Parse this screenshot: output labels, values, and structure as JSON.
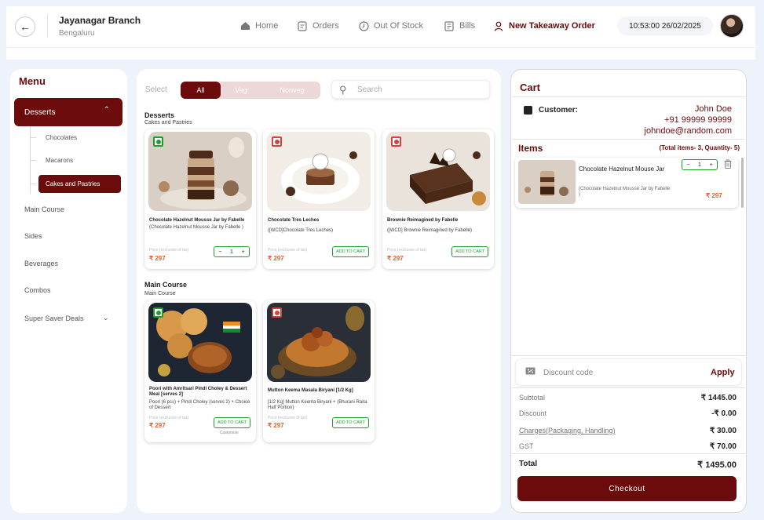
{
  "header": {
    "back_icon": "arrow-left-icon",
    "branch_name": "Jayanagar Branch",
    "city": "Bengaluru",
    "nav": [
      {
        "label": "Home",
        "icon": "home-icon"
      },
      {
        "label": "Orders",
        "icon": "orders-icon"
      },
      {
        "label": "Out Of Stock",
        "icon": "clock-icon"
      },
      {
        "label": "Bills",
        "icon": "bills-icon"
      },
      {
        "label": "New Takeaway Order",
        "icon": "person-icon",
        "active": true
      }
    ],
    "datetime": "10:53:00  26/02/2025"
  },
  "menu": {
    "title": "Menu",
    "active_category": "Desserts",
    "subcategories": [
      "Chocolates",
      "Macarons",
      "Cakes and Pastries"
    ],
    "active_subcategory": "Cakes and Pastries",
    "categories": [
      "Main Course",
      "Sides",
      "Beverages",
      "Combos",
      "Super Saver Deals"
    ]
  },
  "filters": {
    "label": "Select",
    "options": [
      "All",
      "Veg",
      "Nonveg"
    ],
    "selected": "All",
    "search_placeholder": "Search"
  },
  "sections": [
    {
      "title": "Desserts",
      "subtitle": "Cakes and Pastries",
      "products": [
        {
          "name": "Chocolate Hazelnut Mousse Jar by Fabelle",
          "desc": "(Chocolate Hazelnut Mousse Jar by Fabelle )",
          "price_note": "Price (exclusive of tax)",
          "price": "₹ 297",
          "type": "veg",
          "in_cart_qty": "1"
        },
        {
          "name": "Chocolate Tres Leches",
          "desc": "([WCD]Chocolate Tres Leches)",
          "price_note": "Price (exclusive of tax)",
          "price": "₹ 297",
          "type": "nonveg",
          "action": "ADD TO CART"
        },
        {
          "name": "Brownie Reimagined by Fabelle",
          "desc": "([WCD] Brownie Reimagined by Fabelle)",
          "price_note": "Price (exclusive of tax)",
          "price": "₹ 297",
          "type": "nonveg",
          "action": "ADD TO CART"
        }
      ]
    },
    {
      "title": "Main Course",
      "subtitle": "Main Course",
      "products": [
        {
          "name": "Poori with Amritsari Pindi Choley & Dessert Meal [serves 2]",
          "desc": "Poori (6 pcs) + Pindi Choley (serves 2) + Choice of Dessert",
          "price_note": "Price (exclusive of tax)",
          "price": "₹ 297",
          "type": "veg",
          "action": "ADD TO CART",
          "note": "Customise"
        },
        {
          "name": "Mutton Keema Masala Biryani [1/2 Kg]",
          "desc": "[1/2 Kg] Mutton Keema Biryani + (Bhurani Raita Half Portion)",
          "price_note": "Price (exclusive of tax)",
          "price": "₹ 297",
          "type": "nonveg",
          "action": "ADD TO CART"
        }
      ]
    }
  ],
  "cart": {
    "title": "Cart",
    "customer_label": "Customer:",
    "customer_name": "John Doe",
    "customer_phone": "+91 99999 99999",
    "customer_email": "johndoe@random.com",
    "items_title": "Items",
    "items_summary": "(Total items- 3, Quantity- 5)",
    "item": {
      "name": "Chocolate Hazelnut Mouse Jar",
      "desc": "(Chocolate Hazelnut Mousse Jar by Fabelle )",
      "qty": "1",
      "price": "₹ 297"
    },
    "discount_placeholder": "Discount code",
    "apply_label": "Apply",
    "summary": [
      {
        "label": "Subtotal",
        "value": "₹ 1445.00"
      },
      {
        "label": "Discount",
        "value": "-₹ 0.00"
      },
      {
        "label": "Charges(Packaging, Handling)",
        "value": "₹ 30.00"
      },
      {
        "label": "GST",
        "value": "₹ 70.00"
      }
    ],
    "total_label": "Total",
    "total_value": "₹ 1495.00",
    "checkout_label": "Checkout"
  },
  "colors": {
    "brand": "#6b0b0b",
    "price": "#e0622d",
    "veg": "#1f9e2e",
    "nonveg": "#d9403a"
  }
}
